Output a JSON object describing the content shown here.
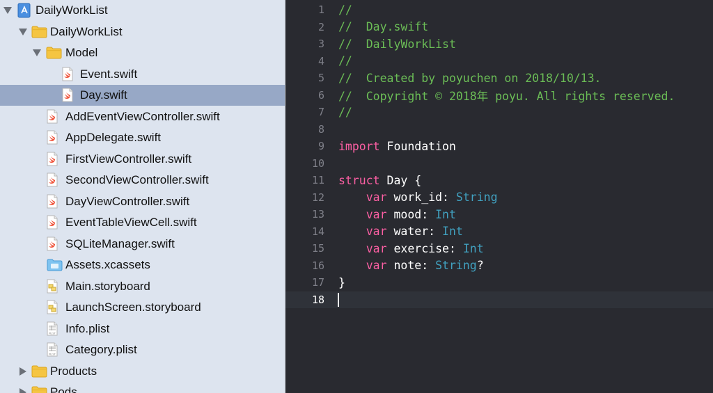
{
  "navigator": {
    "rows": [
      {
        "label": "DailyWorkList",
        "icon": "xcode-project-icon",
        "disclosure": "open"
      },
      {
        "label": "DailyWorkList",
        "icon": "folder-icon",
        "disclosure": "open"
      },
      {
        "label": "Model",
        "icon": "folder-icon",
        "disclosure": "open"
      },
      {
        "label": "Event.swift",
        "icon": "swift-file-icon",
        "disclosure": "none"
      },
      {
        "label": "Day.swift",
        "icon": "swift-file-icon",
        "disclosure": "none",
        "selected": true
      },
      {
        "label": "AddEventViewController.swift",
        "icon": "swift-file-icon",
        "disclosure": "none"
      },
      {
        "label": "AppDelegate.swift",
        "icon": "swift-file-icon",
        "disclosure": "none"
      },
      {
        "label": "FirstViewController.swift",
        "icon": "swift-file-icon",
        "disclosure": "none"
      },
      {
        "label": "SecondViewController.swift",
        "icon": "swift-file-icon",
        "disclosure": "none"
      },
      {
        "label": "DayViewController.swift",
        "icon": "swift-file-icon",
        "disclosure": "none"
      },
      {
        "label": "EventTableViewCell.swift",
        "icon": "swift-file-icon",
        "disclosure": "none"
      },
      {
        "label": "SQLiteManager.swift",
        "icon": "swift-file-icon",
        "disclosure": "none"
      },
      {
        "label": "Assets.xcassets",
        "icon": "asset-catalog-icon",
        "disclosure": "none"
      },
      {
        "label": "Main.storyboard",
        "icon": "storyboard-icon",
        "disclosure": "none"
      },
      {
        "label": "LaunchScreen.storyboard",
        "icon": "storyboard-icon",
        "disclosure": "none"
      },
      {
        "label": "Info.plist",
        "icon": "plist-icon",
        "disclosure": "none"
      },
      {
        "label": "Category.plist",
        "icon": "plist-icon",
        "disclosure": "none"
      },
      {
        "label": "Products",
        "icon": "folder-icon",
        "disclosure": "closed"
      },
      {
        "label": "Pods",
        "icon": "folder-icon",
        "disclosure": "closed"
      }
    ],
    "plist_badge": "PLIST"
  },
  "editor": {
    "lines": [
      {
        "n": "1",
        "tokens": [
          [
            "comment",
            "//"
          ]
        ]
      },
      {
        "n": "2",
        "tokens": [
          [
            "comment",
            "//  Day.swift"
          ]
        ]
      },
      {
        "n": "3",
        "tokens": [
          [
            "comment",
            "//  DailyWorkList"
          ]
        ]
      },
      {
        "n": "4",
        "tokens": [
          [
            "comment",
            "//"
          ]
        ]
      },
      {
        "n": "5",
        "tokens": [
          [
            "comment",
            "//  Created by poyuchen on 2018/10/13."
          ]
        ]
      },
      {
        "n": "6",
        "tokens": [
          [
            "comment",
            "//  Copyright © 2018年 poyu. All rights reserved."
          ]
        ]
      },
      {
        "n": "7",
        "tokens": [
          [
            "comment",
            "//"
          ]
        ]
      },
      {
        "n": "8",
        "tokens": []
      },
      {
        "n": "9",
        "tokens": [
          [
            "kw",
            "import"
          ],
          [
            "plain",
            " Foundation"
          ]
        ]
      },
      {
        "n": "10",
        "tokens": []
      },
      {
        "n": "11",
        "tokens": [
          [
            "kw",
            "struct"
          ],
          [
            "plain",
            " Day {"
          ]
        ]
      },
      {
        "n": "12",
        "tokens": [
          [
            "plain",
            "    "
          ],
          [
            "kw",
            "var"
          ],
          [
            "plain",
            " work_id: "
          ],
          [
            "type",
            "String"
          ]
        ]
      },
      {
        "n": "13",
        "tokens": [
          [
            "plain",
            "    "
          ],
          [
            "kw",
            "var"
          ],
          [
            "plain",
            " mood: "
          ],
          [
            "type",
            "Int"
          ]
        ]
      },
      {
        "n": "14",
        "tokens": [
          [
            "plain",
            "    "
          ],
          [
            "kw",
            "var"
          ],
          [
            "plain",
            " water: "
          ],
          [
            "type",
            "Int"
          ]
        ]
      },
      {
        "n": "15",
        "tokens": [
          [
            "plain",
            "    "
          ],
          [
            "kw",
            "var"
          ],
          [
            "plain",
            " exercise: "
          ],
          [
            "type",
            "Int"
          ]
        ]
      },
      {
        "n": "16",
        "tokens": [
          [
            "plain",
            "    "
          ],
          [
            "kw",
            "var"
          ],
          [
            "plain",
            " note: "
          ],
          [
            "type",
            "String"
          ],
          [
            "plain",
            "?"
          ]
        ]
      },
      {
        "n": "17",
        "tokens": [
          [
            "plain",
            "}"
          ]
        ]
      },
      {
        "n": "18",
        "tokens": [],
        "current": true
      }
    ]
  },
  "colors": {
    "editor_bg": "#292a30",
    "comment": "#6bbd56",
    "keyword": "#fc5fa3",
    "type": "#41a1c0",
    "selection": "#97a8c6"
  }
}
